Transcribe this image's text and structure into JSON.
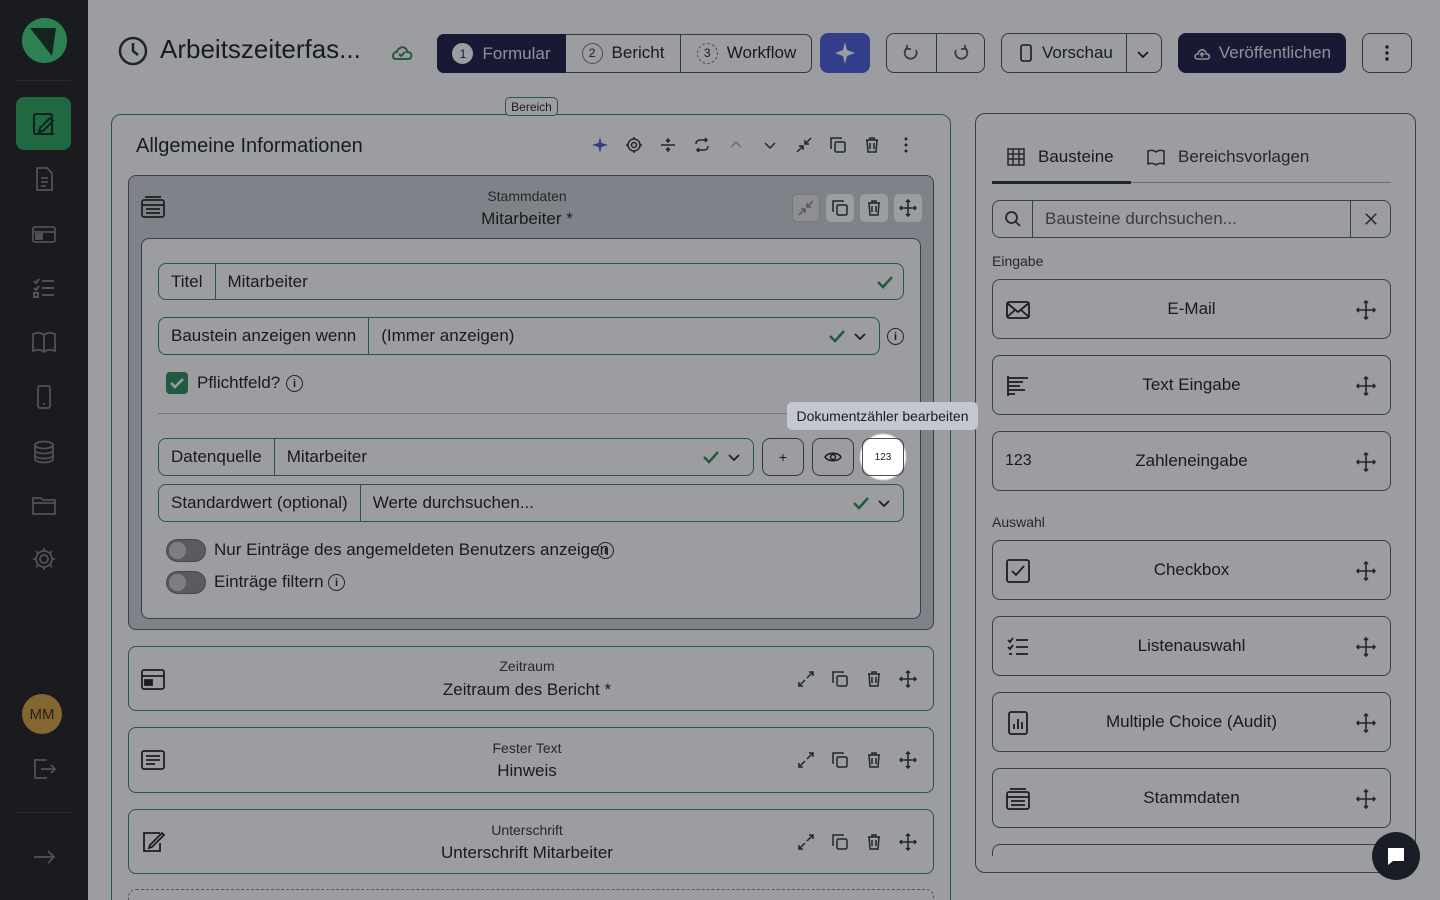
{
  "sidebar": {
    "nav": [
      "editor-icon",
      "document-icon",
      "folder-card-icon",
      "checklist-icon",
      "book-icon",
      "phone-icon",
      "database-icon",
      "folder-icon",
      "gear-icon"
    ],
    "avatar_initials": "MM"
  },
  "header": {
    "title": "Arbeitszeiterfas...",
    "steps": [
      {
        "num": "1",
        "label": "Formular"
      },
      {
        "num": "2",
        "label": "Bericht"
      },
      {
        "num": "3",
        "label": "Workflow"
      }
    ],
    "preview_label": "Vorschau",
    "publish_label": "Veröffentlichen"
  },
  "section": {
    "tab_label": "Bereich",
    "title": "Allgemeine Informationen",
    "stammdaten_block": {
      "type_label": "Stammdaten",
      "name": "Mitarbeiter *",
      "titel_label": "Titel",
      "titel_value": "Mitarbeiter",
      "condition_label": "Baustein anzeigen wenn",
      "condition_value": "(Immer anzeigen)",
      "required_label": "Pflichtfeld?",
      "datasource_label": "Datenquelle",
      "datasource_value": "Mitarbeiter",
      "plus_label": "+",
      "counter_label": "123",
      "tooltip": "Dokumentzähler bearbeiten",
      "default_label": "Standardwert (optional)",
      "default_placeholder": "Werte durchsuchen...",
      "toggle1_label": "Nur Einträge des angemeldeten Benutzers anzeigen",
      "toggle2_label": "Einträge filtern"
    },
    "blocks": [
      {
        "type_label": "Zeitraum",
        "name": "Zeitraum des Bericht *"
      },
      {
        "type_label": "Fester Text",
        "name": "Hinweis"
      },
      {
        "type_label": "Unterschrift",
        "name": "Unterschrift Mitarbeiter"
      }
    ]
  },
  "panel": {
    "tabs": [
      "Bausteine",
      "Bereichsvorlagen"
    ],
    "search_placeholder": "Bausteine durchsuchen...",
    "groups": [
      {
        "label": "Eingabe",
        "items": [
          {
            "label": "E-Mail",
            "icon": "envelope-icon"
          },
          {
            "label": "Text Eingabe",
            "icon": "text-lines-icon"
          },
          {
            "label": "Zahleneingabe",
            "icon_text": "123"
          }
        ]
      },
      {
        "label": "Auswahl",
        "items": [
          {
            "label": "Checkbox",
            "icon": "checkbox-icon"
          },
          {
            "label": "Listenauswahl",
            "icon": "list-icon"
          },
          {
            "label": "Multiple Choice (Audit)",
            "icon": "bar-chart-icon"
          },
          {
            "label": "Stammdaten",
            "icon": "stack-icon"
          }
        ]
      }
    ]
  }
}
